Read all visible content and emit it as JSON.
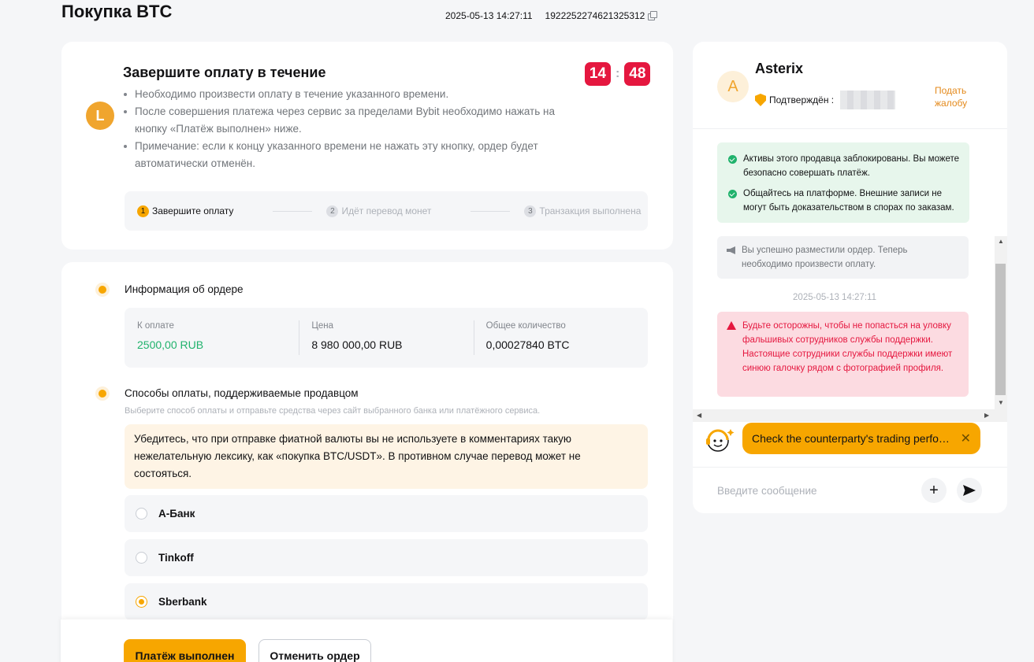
{
  "header": {
    "title": "Покупка BTC",
    "timestamp": "2025-05-13 14:27:11",
    "order_id": "1922252274621325312"
  },
  "payment_notice": {
    "avatar_letter": "L",
    "heading": "Завершите оплату в течение",
    "timer": {
      "minutes": "14",
      "seconds": "48",
      "separator": ":"
    },
    "notes": [
      "Необходимо произвести оплату в течение указанного времени.",
      "После совершения платежа через сервис за пределами Bybit необходимо нажать на кнопку «Платёж выполнен» ниже.",
      "Примечание: если к концу указанного времени не нажать эту кнопку, ордер будет автоматически отменён."
    ],
    "steps": [
      {
        "num": "1",
        "label": "Завершите оплату"
      },
      {
        "num": "2",
        "label": "Идёт перевод монет"
      },
      {
        "num": "3",
        "label": "Транзакция выполнена"
      }
    ]
  },
  "order_info": {
    "title": "Информация об ордере",
    "to_pay_label": "К оплате",
    "to_pay_value": "2500,00 RUB",
    "price_label": "Цена",
    "price_value": "8 980 000,00 RUB",
    "qty_label": "Общее количество",
    "qty_value": "0,00027840 BTC"
  },
  "payment_methods": {
    "title": "Способы оплаты, поддерживаемые продавцом",
    "subtitle": "Выберите способ оплаты и отправьте средства через сайт выбранного банка или платёжного сервиса.",
    "warning": "Убедитесь, что при отправке фиатной валюты вы не используете в комментариях такую нежелательную лексику, как «покупка BTC/USDT». В противном случае перевод может не состояться.",
    "options": [
      {
        "label": "А-Банк",
        "selected": false
      },
      {
        "label": "Tinkoff",
        "selected": false
      },
      {
        "label": "Sberbank",
        "selected": true
      }
    ]
  },
  "actions": {
    "paid_label": "Платёж выполнен",
    "cancel_label": "Отменить ордер"
  },
  "chat": {
    "avatar_letter": "A",
    "name": "Asterix",
    "verified_label": "Подтверждён :",
    "complain_label": "Подать жалобу",
    "safe_notes": [
      "Активы этого продавца заблокированы. Вы можете безопасно совершать платёж.",
      "Общайтесь на платформе. Внешние записи не могут быть доказательством в спорах по заказам."
    ],
    "system_message": "Вы успешно разместили ордер. Теперь необходимо произвести оплату.",
    "message_time": "2025-05-13 14:27:11",
    "danger_message": "Будьте осторожны, чтобы не попасться на уловку фальшивых сотрудников службы поддержки. Настоящие сотрудники службы поддержки имеют синюю галочку рядом с фотографией профиля.",
    "bot_tip": "Check the counterparty's trading performance",
    "input_placeholder": "Введите сообщение"
  },
  "colors": {
    "accent": "#f7a600",
    "success": "#20b26c",
    "danger": "#e5173f"
  },
  "icons": [
    "copy-icon",
    "shield-check-icon",
    "check-circle-icon",
    "megaphone-icon",
    "warning-triangle-icon",
    "bot-icon",
    "close-icon",
    "plus-icon",
    "send-icon"
  ]
}
